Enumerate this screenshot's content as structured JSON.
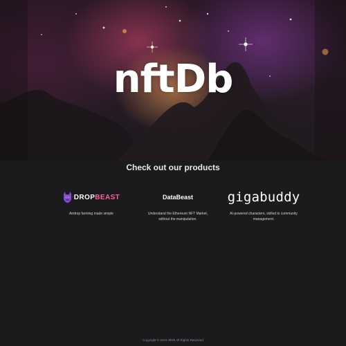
{
  "hero": {
    "logo_text": "nftDb"
  },
  "products_section": {
    "title": "Check out our products",
    "items": [
      {
        "name_part1": "DROP",
        "name_part2": "BEAST",
        "description": "Airdrop farming made simple",
        "accent_color": "#ff5f9c"
      },
      {
        "name": "DataBeast",
        "description_line1": "Understand the Ethereum NFT Market,",
        "description_line2": "without the manipulation."
      },
      {
        "name": "gigabuddy",
        "description_line1": "AI-powered characters, skilled in community",
        "description_line2": "management."
      }
    ]
  },
  "footer": {
    "text": "Copyright © 2023 nftDb All Rights Reserved"
  }
}
